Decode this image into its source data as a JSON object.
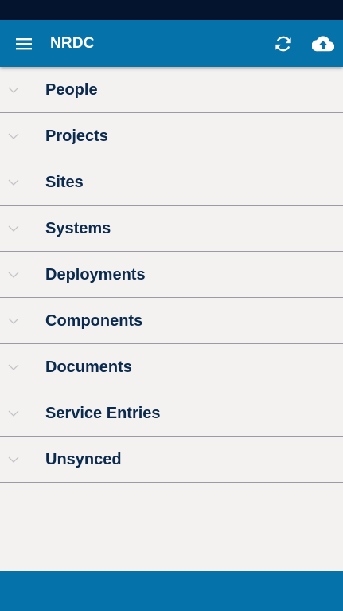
{
  "app_bar": {
    "title": "NRDC",
    "menu_icon": "hamburger-menu-icon",
    "sync_icon": "refresh-sync-icon",
    "upload_icon": "cloud-upload-icon"
  },
  "nav": {
    "items": [
      {
        "label": "People"
      },
      {
        "label": "Projects"
      },
      {
        "label": "Sites"
      },
      {
        "label": "Systems"
      },
      {
        "label": "Deployments"
      },
      {
        "label": "Components"
      },
      {
        "label": "Documents"
      },
      {
        "label": "Service Entries"
      },
      {
        "label": "Unsynced"
      }
    ]
  },
  "colors": {
    "status_bar": "#04142e",
    "app_bar": "#0672aa",
    "background": "#f4f2f1",
    "label_text": "#0b2a4d",
    "divider": "#9b9ba4",
    "chevron": "#c4c4c8"
  }
}
